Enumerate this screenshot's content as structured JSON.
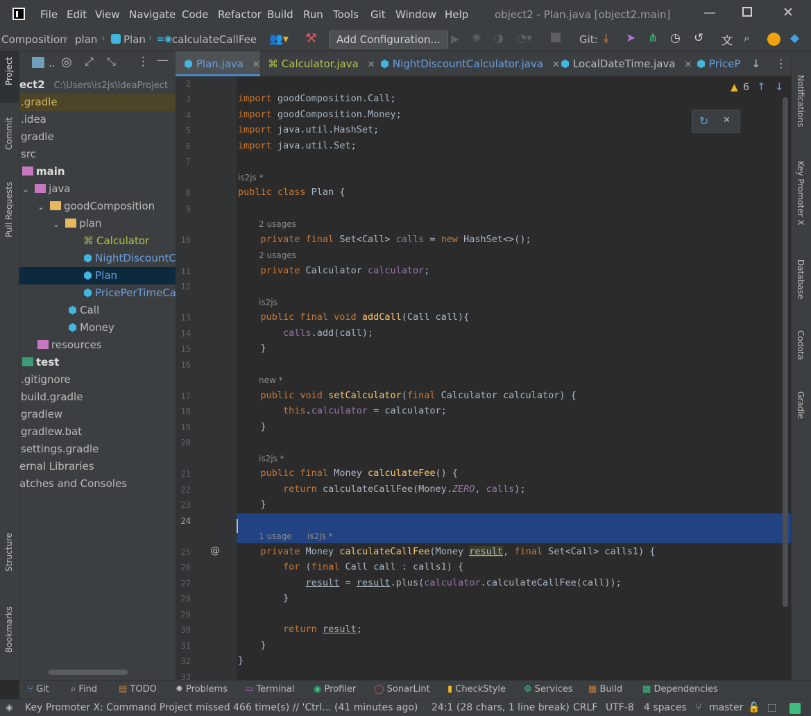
{
  "window": {
    "title": "object2 - Plan.java [object2.main]",
    "menu": [
      "File",
      "Edit",
      "View",
      "Navigate",
      "Code",
      "Refactor",
      "Build",
      "Run",
      "Tools",
      "Git",
      "Window",
      "Help"
    ]
  },
  "breadcrumb": [
    "Composition",
    "plan",
    "Plan",
    "calculateCallFee"
  ],
  "toolbar": {
    "add_configuration": "Add Configuration...",
    "git_label": "Git:"
  },
  "tabs": [
    {
      "label": "Plan.java",
      "active": true
    },
    {
      "label": "Calculator.java",
      "active": false
    },
    {
      "label": "NightDiscountCalculator.java",
      "active": false
    },
    {
      "label": "LocalDateTime.java",
      "active": false
    },
    {
      "label": "PriceP",
      "active": false
    }
  ],
  "left_stripe": [
    "Project",
    "Commit",
    "Pull Requests",
    "Structure",
    "Bookmarks"
  ],
  "right_stripe": [
    "Notifications",
    "Key Promoter X",
    "Database",
    "Codota",
    "Gradle"
  ],
  "project": {
    "root": "ect2",
    "root_path": "C:\\Users\\is2js\\IdeaProject",
    "items": [
      {
        "label": ".gradle"
      },
      {
        "label": ".idea"
      },
      {
        "label": "gradle"
      },
      {
        "label": "src"
      },
      {
        "label": "main"
      },
      {
        "label": "java"
      },
      {
        "label": "goodComposition"
      },
      {
        "label": "plan"
      },
      {
        "label": "Calculator"
      },
      {
        "label": "NightDiscountC"
      },
      {
        "label": "Plan"
      },
      {
        "label": "PricePerTimeCal"
      },
      {
        "label": "Call"
      },
      {
        "label": "Money"
      },
      {
        "label": "resources"
      },
      {
        "label": "test"
      },
      {
        "label": ".gitignore"
      },
      {
        "label": "build.gradle"
      },
      {
        "label": "gradlew"
      },
      {
        "label": "gradlew.bat"
      },
      {
        "label": "settings.gradle"
      },
      {
        "label": "ernal Libraries"
      },
      {
        "label": "atches and Consoles"
      }
    ]
  },
  "editor": {
    "warnings": "6",
    "hints": {
      "h8": "is2js *",
      "h10": "2 usages",
      "h11": "2 usages",
      "h13": "is2js",
      "h17": "new *",
      "h21": "is2js *",
      "h25a": "1 usage",
      "h25b": "is2js *"
    },
    "line_numbers": [
      "2",
      "3",
      "4",
      "5",
      "6",
      "7",
      "8",
      "9",
      "10",
      "11",
      "12",
      "13",
      "14",
      "15",
      "16",
      "17",
      "18",
      "19",
      "20",
      "21",
      "22",
      "23",
      "24",
      "25",
      "26",
      "27",
      "28",
      "29",
      "30",
      "31",
      "32",
      "33"
    ]
  },
  "tool_windows": [
    "Git",
    "Find",
    "TODO",
    "Problems",
    "Terminal",
    "Profiler",
    "SonarLint",
    "CheckStyle",
    "Services",
    "Build",
    "Dependencies"
  ],
  "status": {
    "message": "Key Promoter X: Command Project missed 466 time(s) // 'Ctrl... (41 minutes ago)",
    "position": "24:1 (28 chars, 1 line break)",
    "line_ending": "CRLF",
    "encoding": "UTF-8",
    "indent": "4 spaces",
    "branch": "master"
  }
}
